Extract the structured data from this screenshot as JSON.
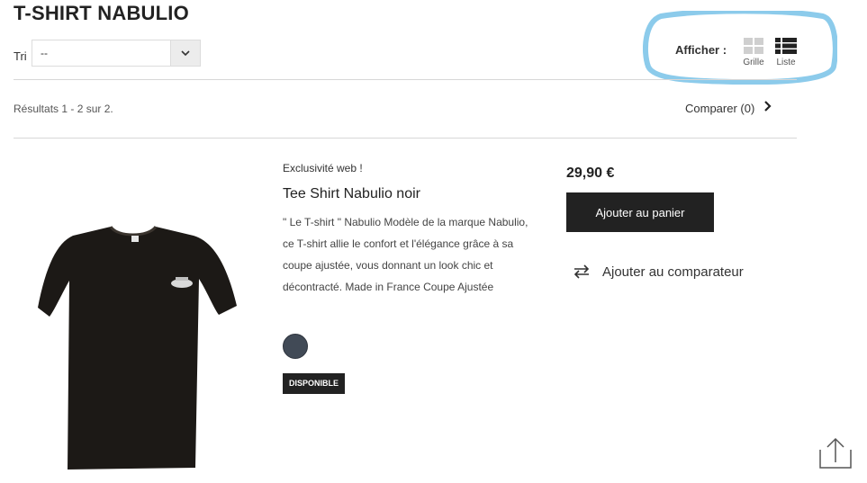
{
  "page": {
    "title": "T-SHIRT NABULIO"
  },
  "sort": {
    "label": "Tri",
    "selected": "--"
  },
  "view": {
    "label": "Afficher :",
    "grid_label": "Grille",
    "list_label": "Liste"
  },
  "results": {
    "text": "Résultats 1 - 2 sur 2."
  },
  "compare": {
    "label": "Comparer",
    "count": "(0)"
  },
  "product": {
    "web_exclusive": "Exclusivité web !",
    "name": "Tee Shirt Nabulio noir",
    "description": "\" Le T-shirt \" Nabulio Modèle de la marque Nabulio, ce T-shirt allie le confort et l'élégance grâce à sa coupe ajustée, vous donnant un look chic et décontracté.    Made in France Coupe Ajustée",
    "availability": "DISPONIBLE",
    "price": "29,90 €",
    "add_to_cart": "Ajouter au panier",
    "add_to_compare": "Ajouter au comparateur",
    "swatch_color": "#414a56"
  },
  "colors": {
    "highlight": "#8ccbeb",
    "dark": "#222222"
  }
}
